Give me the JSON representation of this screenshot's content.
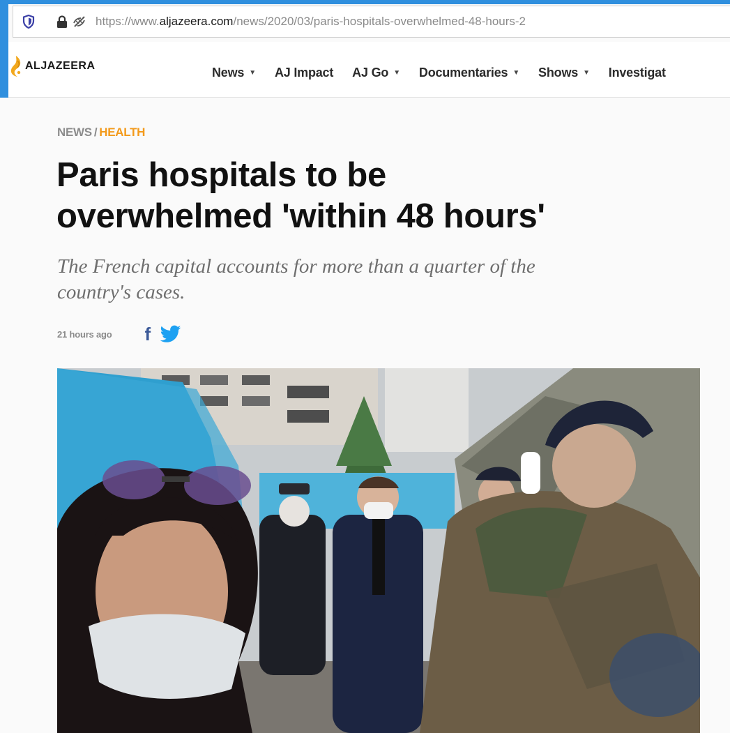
{
  "browser": {
    "url_prefix": "https://www.",
    "url_domain": "aljazeera.com",
    "url_path": "/news/2020/03/paris-hospitals-overwhelmed-48-hours-2",
    "icons": [
      "shield-icon",
      "lock-icon",
      "tracking-protection-icon"
    ]
  },
  "site": {
    "logo_text": "ALJAZEERA",
    "nav": [
      {
        "label": "News",
        "has_dropdown": true
      },
      {
        "label": "AJ Impact",
        "has_dropdown": false
      },
      {
        "label": "AJ Go",
        "has_dropdown": true
      },
      {
        "label": "Documentaries",
        "has_dropdown": true
      },
      {
        "label": "Shows",
        "has_dropdown": true
      },
      {
        "label": "Investigat",
        "has_dropdown": false
      }
    ]
  },
  "article": {
    "breadcrumb": {
      "section": "NEWS",
      "separator": "/",
      "topic": "HEALTH"
    },
    "headline_line1": "Paris hospitals to be",
    "headline_line2": "overwhelmed 'within 48 hours'",
    "standfirst_line1": "The French capital accounts for more than a quarter of the",
    "standfirst_line2": "country's cases.",
    "timestamp": "21 hours ago",
    "share": {
      "facebook_glyph": "f",
      "icons": [
        "facebook-icon",
        "twitter-icon"
      ]
    }
  },
  "colors": {
    "accent_health": "#f39a1b",
    "browser_blue": "#2f8fde",
    "facebook": "#3b5998",
    "twitter": "#1da1f2",
    "logo_gold": "#f2a81d"
  }
}
